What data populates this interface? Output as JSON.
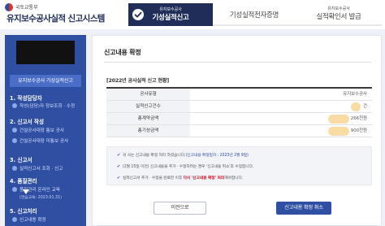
{
  "header": {
    "ministry": "국토교통부",
    "system_title": "유지보수공사실적 신고시스템",
    "steps": [
      {
        "sub": "유지보수공사",
        "main": "기성실적신고"
      },
      {
        "sub": "",
        "main": "기성실적전자증명"
      },
      {
        "sub": "유지보수공사",
        "main": "실적확인서 발급"
      }
    ]
  },
  "sidebar": {
    "title": "유지보수공사 기성실적신고",
    "sections": [
      {
        "label": "1. 작성담당자",
        "items": [
          "작성(담당)자 정보조회 · 수정"
        ]
      },
      {
        "label": "2. 신고서 작성",
        "items": [
          "건설공사대장 통보 공사",
          "건설공사대장 미통보 공사"
        ]
      },
      {
        "label": "3. 신고서",
        "items": [
          "실적신고서 조회 · 신고"
        ]
      },
      {
        "label": "4. 품질관리",
        "items": [
          "품질관리 온라인 교육"
        ],
        "note": "(연습교육: 2023.01.31)"
      },
      {
        "label": "5. 신고처리",
        "items": [
          "신고내용 확정"
        ]
      }
    ]
  },
  "main": {
    "title": "신고내용 확정",
    "section_label": "[2022년 공사실적 신고 현황]",
    "table": {
      "rows": [
        {
          "label": "공사유형",
          "value": "유지보수공사"
        },
        {
          "label": "실적신고건수",
          "value": "건"
        },
        {
          "label": "총계약금액",
          "value": "266천원"
        },
        {
          "label": "총기성금액",
          "value": "900천원"
        }
      ]
    },
    "notices": [
      {
        "pre": "귀 사는 신고내용 확정 처리 하셨습니다.",
        "highlight": "(신고내용 확정일자 : 2023년 2월 9일)",
        "post": ""
      },
      {
        "pre": "(2월 15일 이전) 신고내용을 추가 · 수정하려는 경우 '신고내용 취소'후 수정합니다.",
        "highlight": "",
        "post": ""
      },
      {
        "pre": "실적신고서 추가 · 수정을 완료한 이후 ",
        "red": "다시 '신고내용 확정' 처리",
        "post": "해야합니다."
      }
    ],
    "buttons": {
      "prev": "이전으로",
      "cancel": "신고내용 확정 취소"
    }
  }
}
